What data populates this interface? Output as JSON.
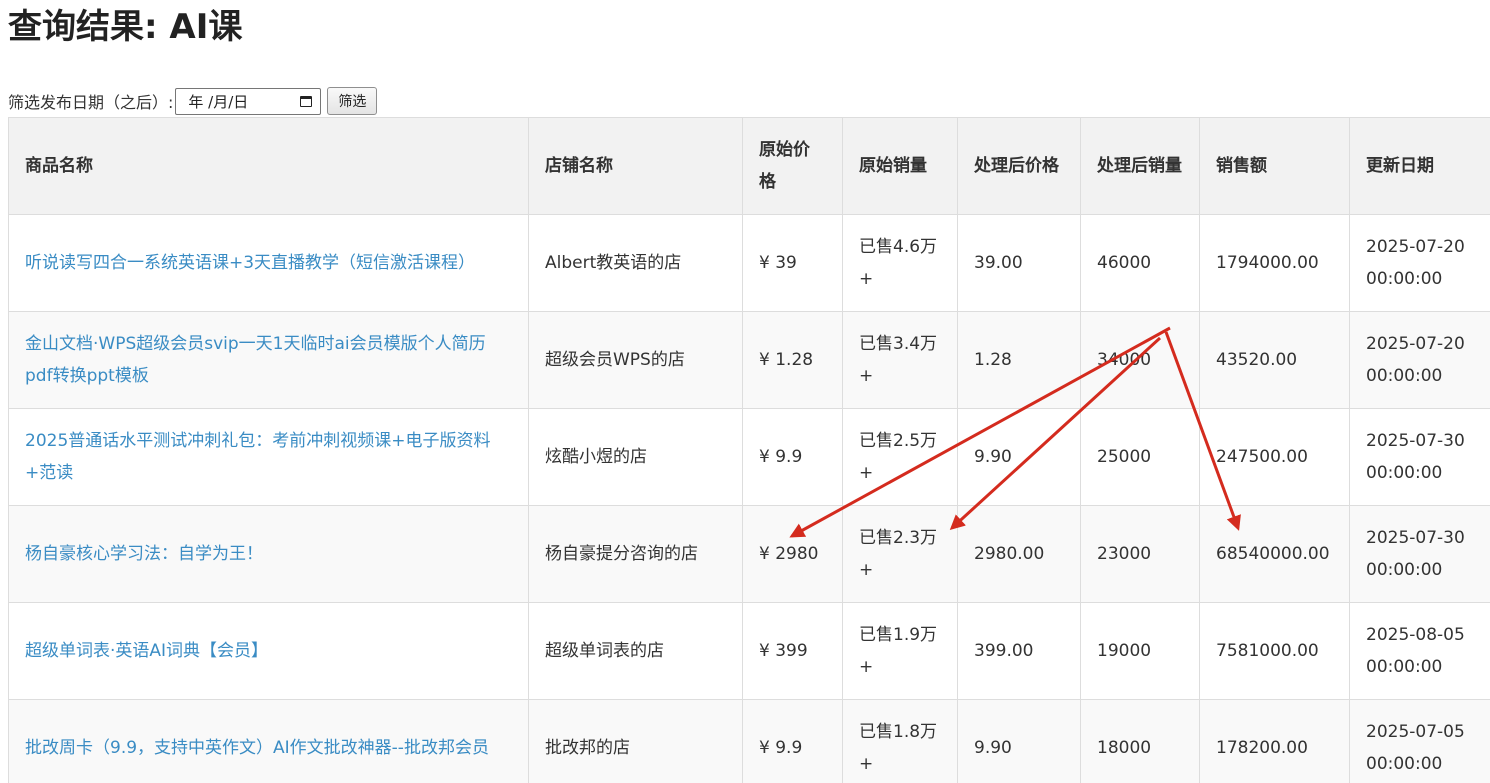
{
  "page": {
    "title": "查询结果: AI课"
  },
  "filter": {
    "label": "筛选发布日期（之后）:",
    "date_placeholder": "年 /月/日",
    "button_label": "筛选"
  },
  "table": {
    "headers": [
      "商品名称",
      "店铺名称",
      "原始价格",
      "原始销量",
      "处理后价格",
      "处理后销量",
      "销售额",
      "更新日期"
    ],
    "rows": [
      {
        "name": "听说读写四合一系统英语课+3天直播教学（短信激活课程）",
        "shop": "Albert教英语的店",
        "price_raw": "¥ 39",
        "sales_raw": "已售4.6万+",
        "price": "39.00",
        "sales": "46000",
        "revenue": "1794000.00",
        "updated": "2025-07-20 00:00:00"
      },
      {
        "name": "金山文档·WPS超级会员svip一天1天临时ai会员模版个人简历pdf转换ppt模板",
        "shop": "超级会员WPS的店",
        "price_raw": "¥ 1.28",
        "sales_raw": "已售3.4万+",
        "price": "1.28",
        "sales": "34000",
        "revenue": "43520.00",
        "updated": "2025-07-20 00:00:00"
      },
      {
        "name": "2025普通话水平测试冲刺礼包：考前冲刺视频课+电子版资料+范读",
        "shop": "炫酷小煜的店",
        "price_raw": "¥ 9.9",
        "sales_raw": "已售2.5万+",
        "price": "9.90",
        "sales": "25000",
        "revenue": "247500.00",
        "updated": "2025-07-30 00:00:00"
      },
      {
        "name": "杨自豪核心学习法：自学为王！",
        "shop": "杨自豪提分咨询的店",
        "price_raw": "¥ 2980",
        "sales_raw": "已售2.3万+",
        "price": "2980.00",
        "sales": "23000",
        "revenue": "68540000.00",
        "updated": "2025-07-30 00:00:00"
      },
      {
        "name": "超级单词表·英语AI词典【会员】",
        "shop": "超级单词表的店",
        "price_raw": "¥ 399",
        "sales_raw": "已售1.9万+",
        "price": "399.00",
        "sales": "19000",
        "revenue": "7581000.00",
        "updated": "2025-08-05 00:00:00"
      },
      {
        "name": "批改周卡（9.9，支持中英作文）AI作文批改神器--批改邦会员",
        "shop": "批改邦的店",
        "price_raw": "¥ 9.9",
        "sales_raw": "已售1.8万+",
        "price": "9.90",
        "sales": "18000",
        "revenue": "178200.00",
        "updated": "2025-07-05 00:00:00"
      }
    ]
  },
  "colors": {
    "link": "#3a8cc4",
    "annotation_arrow": "#d42b1e",
    "header_bg": "#f2f2f2",
    "stripe_bg": "#f9f9f9",
    "border": "#dddddd"
  }
}
